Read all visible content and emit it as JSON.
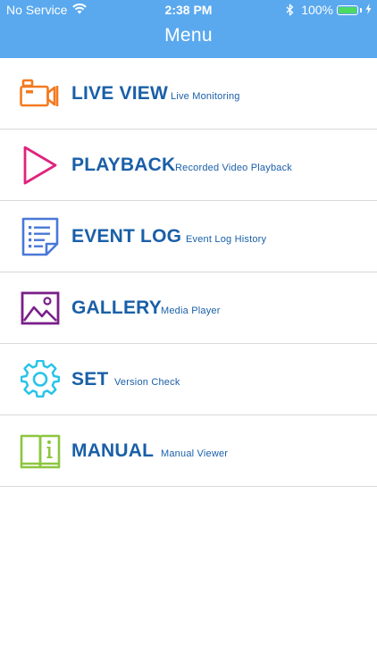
{
  "status_bar": {
    "carrier": "No Service",
    "time": "2:38 PM",
    "battery": "100%"
  },
  "header": {
    "title": "Menu"
  },
  "menu": [
    {
      "label": "LIVE VIEW",
      "sub": "Live Monitoring",
      "icon": "video-camera-icon",
      "color": "#f47a20"
    },
    {
      "label": "PLAYBACK",
      "sub": "Recorded Video Playback",
      "icon": "play-icon",
      "color": "#e0237e"
    },
    {
      "label": "EVENT LOG",
      "sub": "Event Log History",
      "icon": "document-list-icon",
      "color": "#4a78d8"
    },
    {
      "label": "GALLERY",
      "sub": "Media Player",
      "icon": "image-icon",
      "color": "#7a1f8a"
    },
    {
      "label": "SET",
      "sub": "Version Check",
      "icon": "gear-icon",
      "color": "#27c3e8"
    },
    {
      "label": "MANUAL",
      "sub": "Manual Viewer",
      "icon": "book-info-icon",
      "color": "#8cc63f"
    }
  ],
  "colors": {
    "header_bg": "#5aa9ef",
    "label_text": "#1a5fa8",
    "battery_fill": "#4cd964"
  }
}
